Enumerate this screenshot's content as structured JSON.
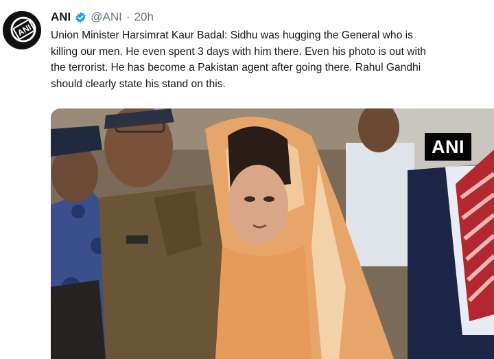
{
  "tweet": {
    "author_name": "ANI",
    "handle": "@ANI",
    "separator": "·",
    "time": "20h",
    "text_lines": [
      "Union Minister Harsimrat Kaur Badal: Sidhu was hugging the General who is",
      "killing our men. He even spent 3 days with him there. Even his photo is out with",
      "the terrorist. He has become a Pakistan agent after going there. Rahul Gandhi",
      "should clearly state his stand on this."
    ],
    "avatar_logo_text": "ANI",
    "media": {
      "watermark_text": "ANI"
    }
  },
  "colors": {
    "verified_badge": "#1da1f2",
    "secondary_text": "#657786",
    "primary_text": "#14171a"
  }
}
